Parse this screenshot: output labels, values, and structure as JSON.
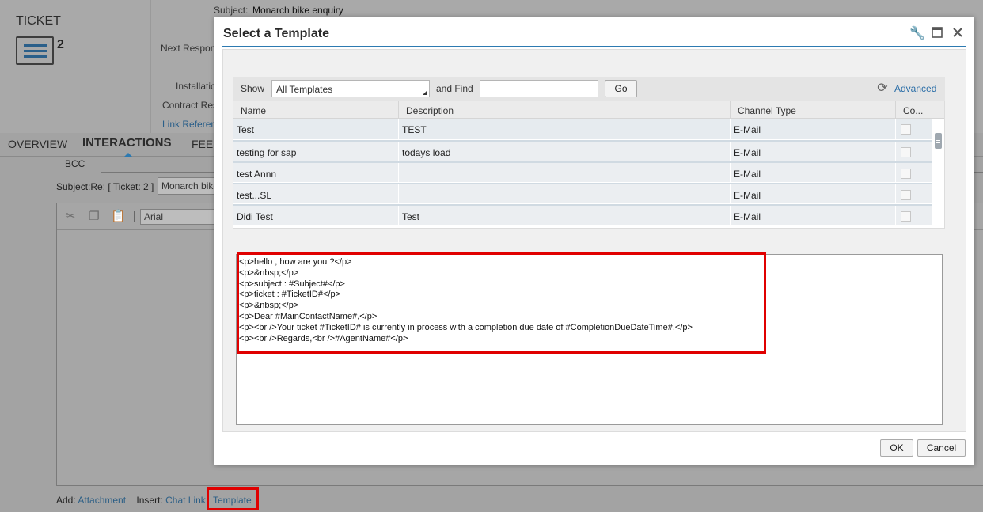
{
  "background": {
    "ticket_title": "TICKET",
    "ticket_number": "2",
    "subject_label": "Subject:",
    "subject_value": "Monarch bike enquiry",
    "next_response_label": "Next Respon",
    "installation_label": "Installatio",
    "contract_label": "Contract Res",
    "link_reference_label": "Link Referen",
    "tabs": [
      {
        "label": "OVERVIEW"
      },
      {
        "label": "INTERACTIONS"
      },
      {
        "label": "FEE"
      }
    ],
    "compose": {
      "bcc_label": "BCC",
      "subject_prefix": "Subject:Re: [ Ticket: 2 ]",
      "subject_input": "Monarch bike",
      "font_value": "Arial",
      "add_label": "Add:",
      "attachment_link": "Attachment",
      "insert_label": "Insert:",
      "chat_link": "Chat Link",
      "template_link": "Template"
    }
  },
  "dialog": {
    "title": "Select a Template",
    "filter": {
      "show_label": "Show",
      "show_value": "All Templates",
      "find_label": "and Find",
      "find_value": "",
      "go_label": "Go",
      "advanced_label": "Advanced"
    },
    "columns": [
      "Name",
      "Description",
      "Channel Type",
      "Co..."
    ],
    "rows": [
      {
        "name": "Test",
        "description": "TEST",
        "channel": "E-Mail"
      },
      {
        "name": "testing for sap",
        "description": "todays load",
        "channel": "E-Mail"
      },
      {
        "name": "test Annn",
        "description": "",
        "channel": "E-Mail"
      },
      {
        "name": "test...SL",
        "description": "",
        "channel": "E-Mail"
      },
      {
        "name": "Didi Test",
        "description": "Test",
        "channel": "E-Mail"
      }
    ],
    "preview_lines": [
      "<p>hello , how are you ?</p>",
      "<p>&nbsp;</p>",
      "<p>subject : #Subject#</p>",
      "<p>ticket : #TicketID#</p>",
      "<p>&nbsp;</p>",
      "<p>Dear #MainContactName#,</p>",
      "<p><br />Your ticket #TicketID# is currently in process with a completion due date of #CompletionDueDateTime#.</p>",
      "<p><br />Regards,<br />#AgentName#</p>"
    ],
    "ok_label": "OK",
    "cancel_label": "Cancel"
  },
  "colors": {
    "accent": "#2d7ab1",
    "highlight": "#e00000",
    "link": "#2c6fa8"
  }
}
